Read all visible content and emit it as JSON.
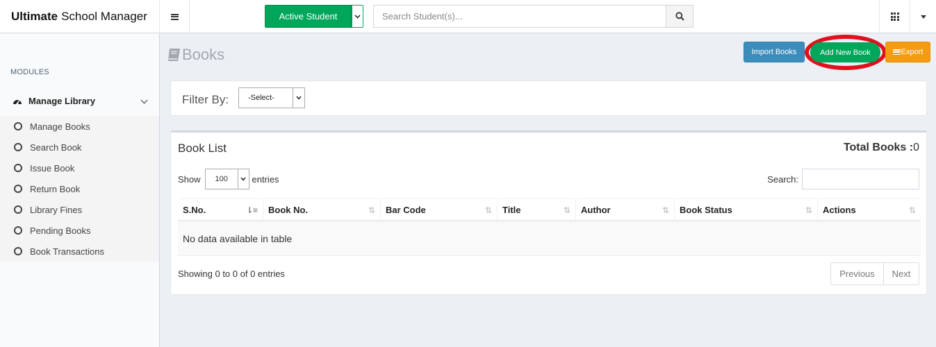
{
  "header": {
    "brand_bold": "Ultimate",
    "brand_rest": "School Manager",
    "active_student_label": "Active Student",
    "search_placeholder": "Search Student(s)..."
  },
  "sidebar": {
    "section_label": "MODULES",
    "group_label": "Manage Library",
    "items": [
      {
        "label": "Manage Books"
      },
      {
        "label": "Search Book"
      },
      {
        "label": "Issue Book"
      },
      {
        "label": "Return Book"
      },
      {
        "label": "Library Fines"
      },
      {
        "label": "Pending Books"
      },
      {
        "label": "Book Transactions"
      }
    ]
  },
  "page": {
    "title": "Books",
    "buttons": {
      "import": "Import Books",
      "add": "Add New Book",
      "export": "Export"
    }
  },
  "filter": {
    "label": "Filter By:",
    "selected": "-Select-"
  },
  "book_list": {
    "title": "Book List",
    "total_label": "Total Books :",
    "total_value": "0",
    "show_label": "Show",
    "page_length": "100",
    "entries_label": "entries",
    "search_label": "Search:",
    "columns": [
      "S.No.",
      "Book No.",
      "Bar Code",
      "Title",
      "Author",
      "Book Status",
      "Actions"
    ],
    "empty_message": "No data available in table",
    "info": "Showing 0 to 0 of 0 entries",
    "pagination": {
      "prev": "Previous",
      "next": "Next"
    }
  },
  "colors": {
    "green": "#00a65a",
    "blue": "#3c8dbc",
    "orange": "#f39c12",
    "annotation_red": "#e0101d"
  }
}
